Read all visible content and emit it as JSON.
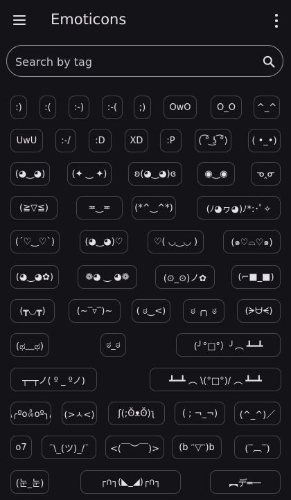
{
  "appbar": {
    "title": "Emoticons",
    "menu_icon": "menu-icon",
    "more_icon": "more-vert-icon"
  },
  "search": {
    "placeholder": "Search by tag",
    "value": "",
    "icon": "search-icon"
  },
  "emoticons": [
    [
      ":)",
      ":(",
      ":-)",
      ":-(",
      ";)",
      "OwO",
      "O_O",
      "^_^"
    ],
    [
      "UwU",
      ":-/",
      ":D",
      "XD",
      ":P",
      "( ͡° ͜ʖ ͡°)",
      "( •_•)"
    ],
    [
      "(◕‿◕)",
      "(✦ ‿ ✦)",
      "ʚ(◕‿◕)ɞ",
      "◉‿◉",
      "ᓀ‸ᓂ"
    ],
    [
      "(≧▽≦)",
      "≖‿≖",
      "(*^‿^*)",
      "(ﾉ◕ヮ◕)ﾉ*:･ﾟ✧"
    ],
    [
      "(´♡‿♡`)",
      "(◕‿◕)♡",
      "♡( ◡‿◡ )",
      "(๑♡⌓♡๑)"
    ],
    [
      "(◕‿◕✿)",
      "❁◕ ‿ ◕❁",
      "(⊙_⊙)ノ✿",
      "(⌐■_■)"
    ],
    [
      "(┳◡┳)",
      "(~‾▿‾)~",
      "( ಠ‿<)",
      "ಠ ╭╮ ಠ",
      "(ᗒᗨᗕ)"
    ],
    [
      "(ಥ﹏ಥ)",
      "ಠ_ಠ",
      "(╯°□°）╯︵ ┻━┻"
    ],
    [
      "┬─┬ノ( º _ ºノ)",
      "┻━┻ ︵ \\(°□°)/ ︵ ┻━┻"
    ],
    [
      "/╲/\\╭ºoꍘoº╮/\\╱\\",
      "(>ㅅ<)",
      "ʃ(;ʘ̆ᴥʘ̆)ʅ",
      "( ; ¬_¬)",
      "(^_^)／"
    ],
    [
      "o7",
      "¯\\_(ツ)_/¯",
      "<(￣︶￣)>",
      "(b ᵔ▽ᵔ)b",
      "(‾︹‾)"
    ],
    [
      "(눈_눈)",
      "┌∩┐(◣_◢)┌∩┐",
      "︻デ═一"
    ]
  ]
}
